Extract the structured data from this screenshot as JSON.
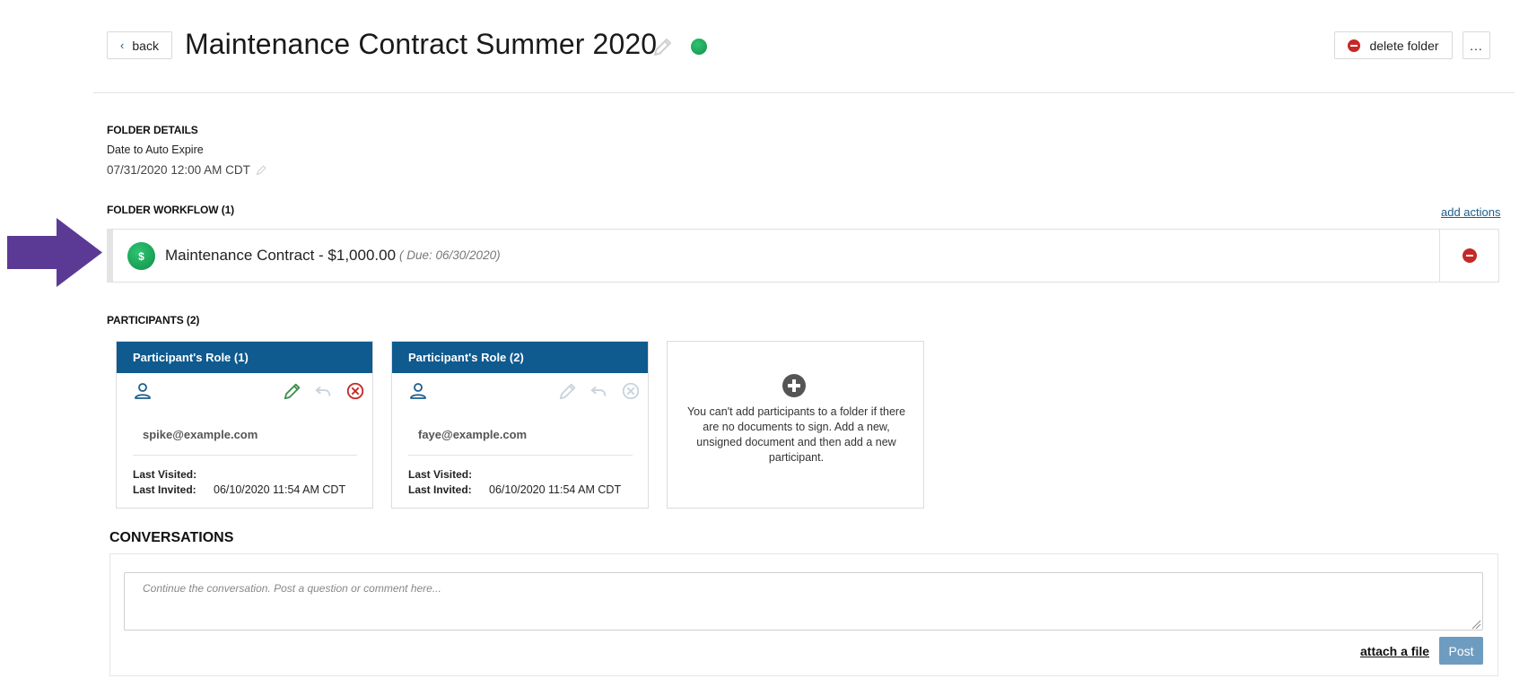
{
  "header": {
    "back_label": "back",
    "title": "Maintenance Contract Summer 2020",
    "delete_label": "delete folder",
    "more_label": "...",
    "status_color": "#1aa85a"
  },
  "folder_details": {
    "heading": "FOLDER DETAILS",
    "expire_label": "Date to Auto Expire",
    "expire_value": "07/31/2020 12:00 AM CDT"
  },
  "workflow": {
    "heading": "FOLDER WORKFLOW (1)",
    "add_actions_label": "add actions",
    "items": [
      {
        "icon": "$",
        "name": "Maintenance Contract - $1,000.00",
        "due": "( Due: 06/30/2020)"
      }
    ]
  },
  "participants": {
    "heading": "PARTICIPANTS (2)",
    "cards": [
      {
        "role": "Participant's Role (1)",
        "email": "spike@example.com",
        "last_visited_label": "Last Visited:",
        "last_visited": "",
        "last_invited_label": "Last Invited:",
        "last_invited": "06/10/2020 11:54 AM CDT"
      },
      {
        "role": "Participant's Role (2)",
        "email": "faye@example.com",
        "last_visited_label": "Last Visited:",
        "last_visited": "",
        "last_invited_label": "Last Invited:",
        "last_invited": "06/10/2020 11:54 AM CDT"
      }
    ],
    "add_message": "You can't add participants to a folder if there are no documents to sign. Add a new, unsigned document and then add a new participant."
  },
  "conversations": {
    "heading": "CONVERSATIONS",
    "placeholder": "Continue the conversation. Post a question or comment here...",
    "attach_label": "attach a file",
    "post_label": "Post"
  },
  "colors": {
    "accent_blue": "#0f5a8e",
    "danger_red": "#c62828",
    "success_green": "#1aa85a",
    "annotation_purple": "#5b3a96"
  }
}
